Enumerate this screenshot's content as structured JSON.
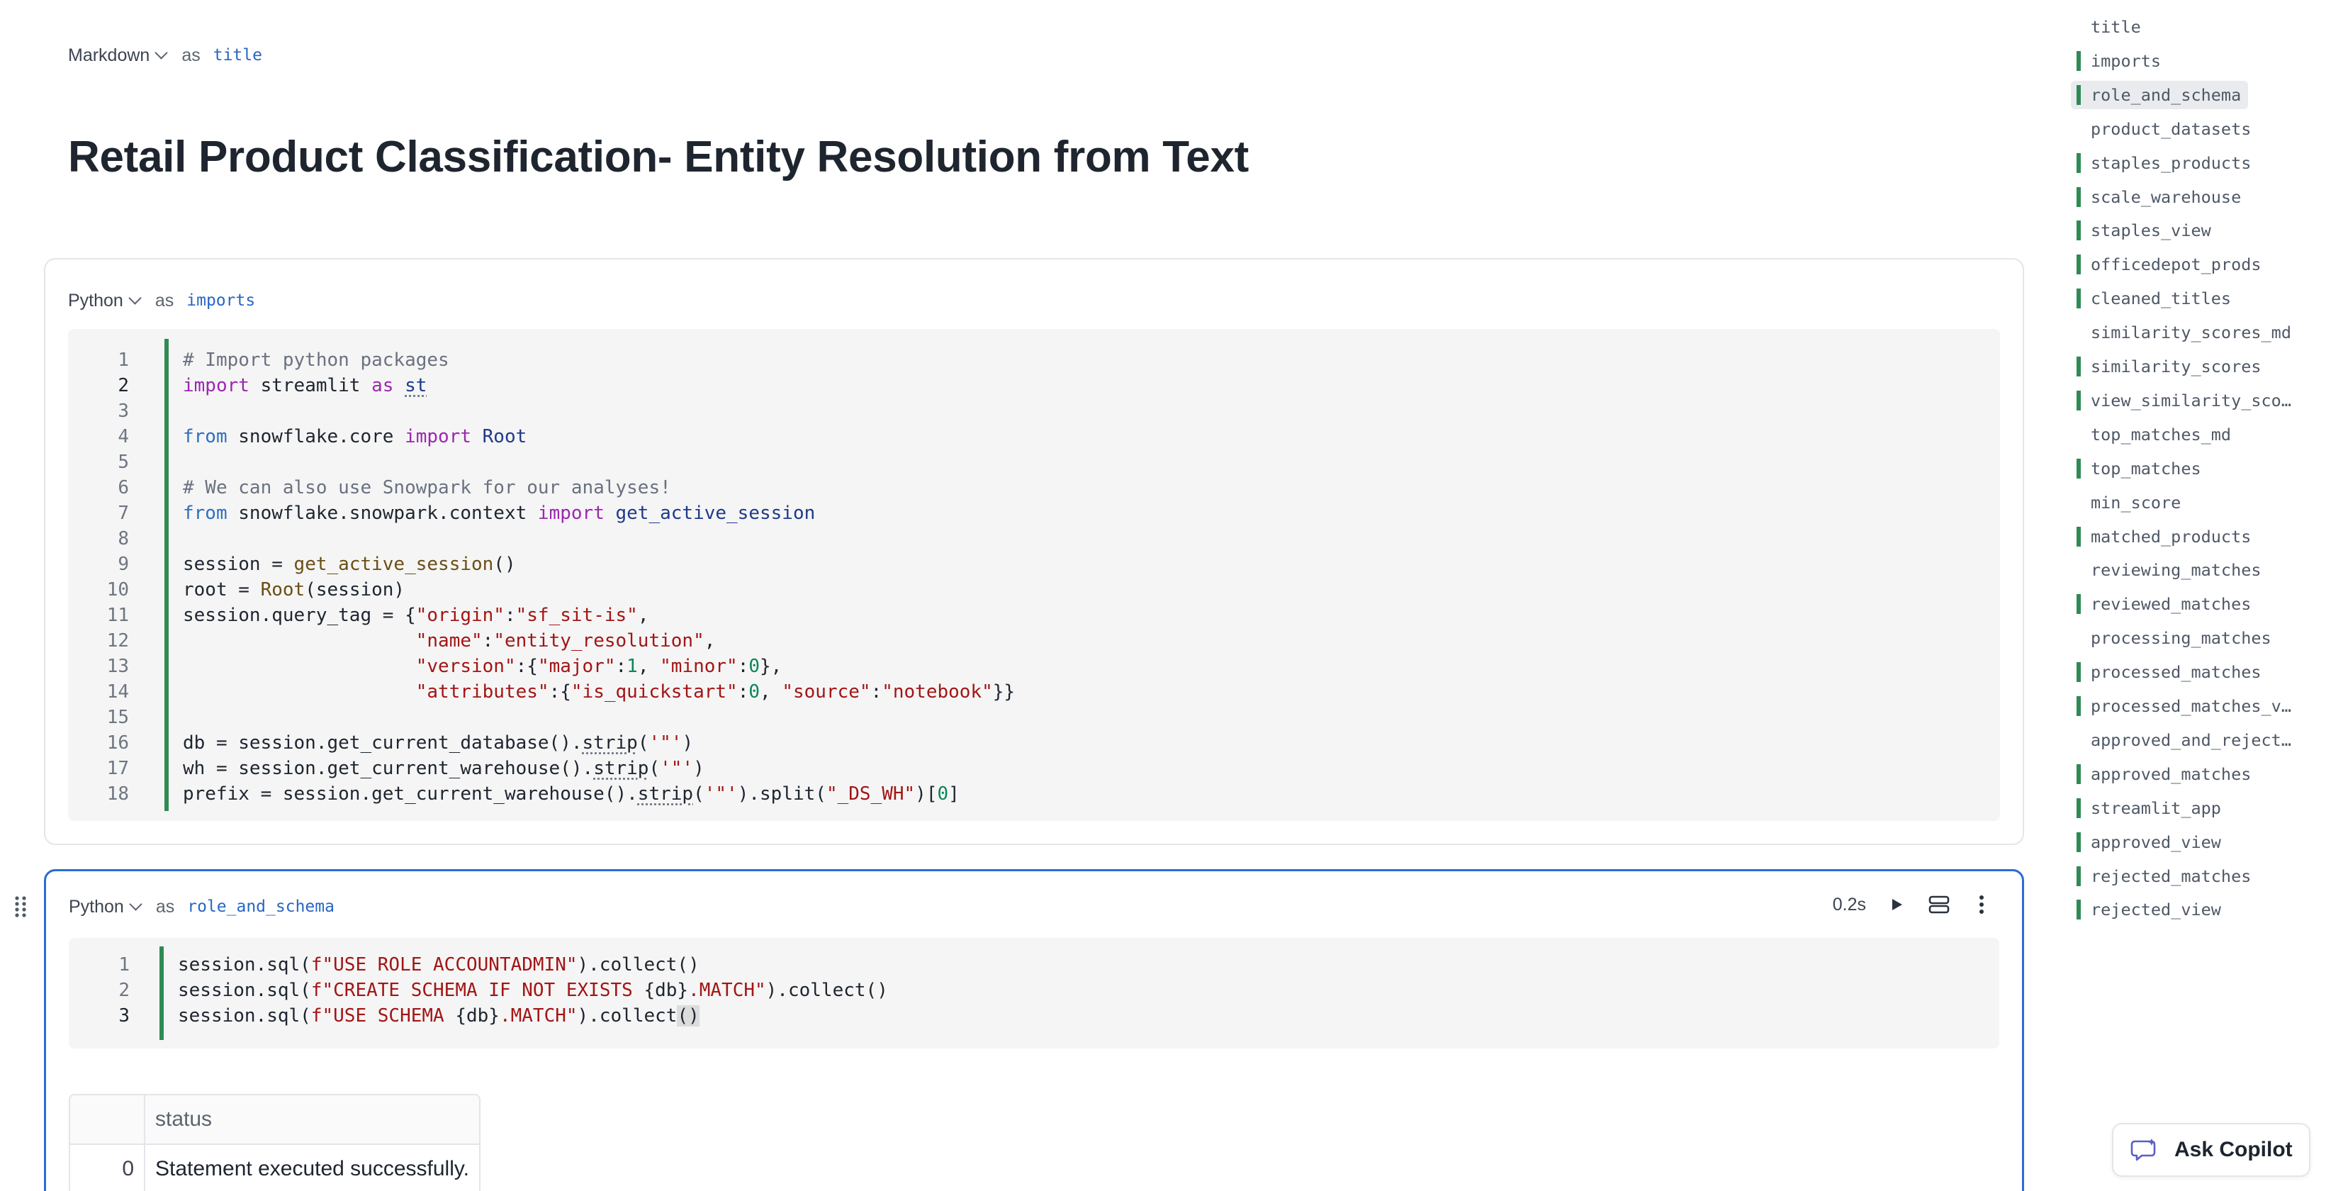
{
  "cells": [
    {
      "language": "Markdown",
      "as_label": "as",
      "name": "title",
      "heading": "Retail Product Classification- Entity Resolution from Text"
    },
    {
      "language": "Python",
      "as_label": "as",
      "name": "imports",
      "line_numbers": [
        "1",
        "2",
        "3",
        "4",
        "5",
        "6",
        "7",
        "8",
        "9",
        "10",
        "11",
        "12",
        "13",
        "14",
        "15",
        "16",
        "17",
        "18"
      ]
    },
    {
      "language": "Python",
      "as_label": "as",
      "name": "role_and_schema",
      "exec_time": "0.2s",
      "line_numbers": [
        "1",
        "2",
        "3"
      ],
      "result": {
        "columns": [
          "",
          "status"
        ],
        "rows": [
          [
            "0",
            "Statement executed successfully."
          ]
        ]
      }
    }
  ],
  "code_imports": [
    [
      [
        "cm",
        "# Import python packages"
      ]
    ],
    [
      [
        "kw",
        "import"
      ],
      [
        "p",
        " streamlit "
      ],
      [
        "kw",
        "as"
      ],
      [
        "p",
        " "
      ],
      [
        "idu",
        "st"
      ]
    ],
    [],
    [
      [
        "kb",
        "from"
      ],
      [
        "p",
        " snowflake.core "
      ],
      [
        "kw",
        "import"
      ],
      [
        "p",
        " "
      ],
      [
        "id",
        "Root"
      ]
    ],
    [],
    [
      [
        "cm",
        "# We can also use Snowpark for our analyses!"
      ]
    ],
    [
      [
        "kb",
        "from"
      ],
      [
        "p",
        " snowflake.snowpark.context "
      ],
      [
        "kw",
        "import"
      ],
      [
        "p",
        " "
      ],
      [
        "id",
        "get_active_session"
      ]
    ],
    [],
    [
      [
        "p",
        "session = "
      ],
      [
        "fn",
        "get_active_session"
      ],
      [
        "p",
        "()"
      ]
    ],
    [
      [
        "p",
        "root = "
      ],
      [
        "fn",
        "Root"
      ],
      [
        "p",
        "(session)"
      ]
    ],
    [
      [
        "p",
        "session.query_tag = {"
      ],
      [
        "st",
        "\"origin\""
      ],
      [
        "p",
        ":"
      ],
      [
        "st",
        "\"sf_sit-is\""
      ],
      [
        "p",
        ","
      ]
    ],
    [
      [
        "p",
        "                     "
      ],
      [
        "st",
        "\"name\""
      ],
      [
        "p",
        ":"
      ],
      [
        "st",
        "\"entity_resolution\""
      ],
      [
        "p",
        ","
      ]
    ],
    [
      [
        "p",
        "                     "
      ],
      [
        "st",
        "\"version\""
      ],
      [
        "p",
        ":{"
      ],
      [
        "st",
        "\"major\""
      ],
      [
        "p",
        ":"
      ],
      [
        "num",
        "1"
      ],
      [
        "p",
        ", "
      ],
      [
        "st",
        "\"minor\""
      ],
      [
        "p",
        ":"
      ],
      [
        "num",
        "0"
      ],
      [
        "p",
        "},"
      ]
    ],
    [
      [
        "p",
        "                     "
      ],
      [
        "st",
        "\"attributes\""
      ],
      [
        "p",
        ":{"
      ],
      [
        "st",
        "\"is_quickstart\""
      ],
      [
        "p",
        ":"
      ],
      [
        "num",
        "0"
      ],
      [
        "p",
        ", "
      ],
      [
        "st",
        "\"source\""
      ],
      [
        "p",
        ":"
      ],
      [
        "st",
        "\"notebook\""
      ],
      [
        "p",
        "}}"
      ]
    ],
    [],
    [
      [
        "p",
        "db = session.get_current_database()."
      ],
      [
        "pu",
        "strip"
      ],
      [
        "p",
        "("
      ],
      [
        "st",
        "'\"'"
      ],
      [
        "p",
        ")"
      ]
    ],
    [
      [
        "p",
        "wh = session.get_current_warehouse()."
      ],
      [
        "pu",
        "strip"
      ],
      [
        "p",
        "("
      ],
      [
        "st",
        "'\"'"
      ],
      [
        "p",
        ")"
      ]
    ],
    [
      [
        "p",
        "prefix = session.get_current_warehouse()."
      ],
      [
        "pu",
        "strip"
      ],
      [
        "p",
        "("
      ],
      [
        "st",
        "'\"'"
      ],
      [
        "p",
        ").split("
      ],
      [
        "st",
        "\"_DS_WH\""
      ],
      [
        "p",
        ")["
      ],
      [
        "num",
        "0"
      ],
      [
        "p",
        "]"
      ]
    ]
  ],
  "code_role": [
    [
      [
        "p",
        "session.sql("
      ],
      [
        "st",
        "f\"USE ROLE ACCOUNTADMIN\""
      ],
      [
        "p",
        ").collect()"
      ]
    ],
    [
      [
        "p",
        "session.sql("
      ],
      [
        "st",
        "f\"CREATE SCHEMA IF NOT EXISTS "
      ],
      [
        "p",
        "{db}"
      ],
      [
        "st",
        ".MATCH\""
      ],
      [
        "p",
        ").collect()"
      ]
    ],
    [
      [
        "p",
        "session.sql("
      ],
      [
        "st",
        "f\"USE SCHEMA "
      ],
      [
        "p",
        "{db}"
      ],
      [
        "st",
        ".MATCH\""
      ],
      [
        "p",
        ").collect"
      ],
      [
        "br",
        "()"
      ]
    ]
  ],
  "outline": [
    {
      "label": "title",
      "marked": false
    },
    {
      "label": "imports",
      "marked": true
    },
    {
      "label": "role_and_schema",
      "marked": true,
      "selected": true
    },
    {
      "label": "product_datasets",
      "marked": false
    },
    {
      "label": "staples_products",
      "marked": true
    },
    {
      "label": "scale_warehouse",
      "marked": true
    },
    {
      "label": "staples_view",
      "marked": true
    },
    {
      "label": "officedepot_prods",
      "marked": true
    },
    {
      "label": "cleaned_titles",
      "marked": true
    },
    {
      "label": "similarity_scores_md",
      "marked": false
    },
    {
      "label": "similarity_scores",
      "marked": true
    },
    {
      "label": "view_similarity_sco…",
      "marked": true
    },
    {
      "label": "top_matches_md",
      "marked": false
    },
    {
      "label": "top_matches",
      "marked": true
    },
    {
      "label": "min_score",
      "marked": false
    },
    {
      "label": "matched_products",
      "marked": true
    },
    {
      "label": "reviewing_matches",
      "marked": false
    },
    {
      "label": "reviewed_matches",
      "marked": true
    },
    {
      "label": "processing_matches",
      "marked": false
    },
    {
      "label": "processed_matches",
      "marked": true
    },
    {
      "label": "processed_matches_v…",
      "marked": true
    },
    {
      "label": "approved_and_reject…",
      "marked": false
    },
    {
      "label": "approved_matches",
      "marked": true
    },
    {
      "label": "streamlit_app",
      "marked": true
    },
    {
      "label": "approved_view",
      "marked": true
    },
    {
      "label": "rejected_matches",
      "marked": true
    },
    {
      "label": "rejected_view",
      "marked": true
    }
  ],
  "copilot": {
    "label": "Ask Copilot"
  },
  "colors": {
    "accent_blue": "#2b6cd4",
    "run_bar_green": "#2f8a55"
  },
  "icons": {
    "run": "play-icon",
    "layout": "stacked-layout-icon",
    "more": "more-vertical-icon",
    "drag": "drag-handle-icon",
    "copilot": "copilot-chat-icon"
  }
}
